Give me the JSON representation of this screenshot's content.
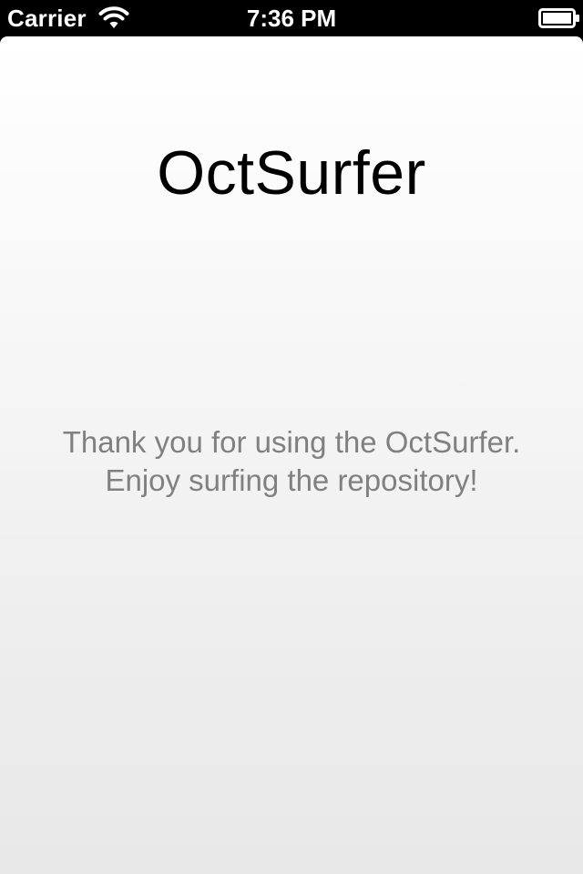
{
  "status_bar": {
    "carrier": "Carrier",
    "time": "7:36 PM",
    "icons": [
      "wifi-icon",
      "battery-icon"
    ]
  },
  "main": {
    "title": "OctSurfer",
    "message_lines": [
      "Thank you for using the OctSurfer.",
      "Enjoy surfing the repository!"
    ]
  },
  "colors": {
    "status_bar_bg": "#000000",
    "title_text": "#000000",
    "message_text": "#808080"
  }
}
